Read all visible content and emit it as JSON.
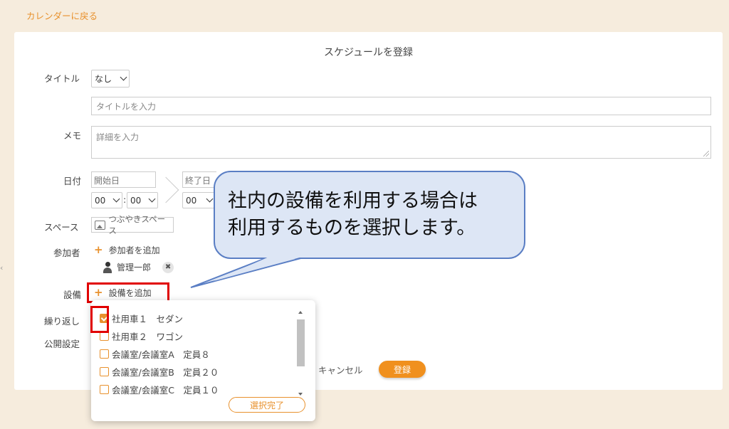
{
  "nav": {
    "back_label": "カレンダーに戻る",
    "left_arrow": "‹"
  },
  "form": {
    "title": "スケジュールを登録",
    "title_label": "タイトル",
    "title_select_value": "なし",
    "title_placeholder": "タイトルを入力",
    "memo_label": "メモ",
    "memo_placeholder": "詳細を入力",
    "date_label": "日付",
    "start_date_placeholder": "開始日",
    "end_date_placeholder": "終了日",
    "start_hour": "00",
    "time_colon": ":",
    "start_minute": "00",
    "end_hour": "00",
    "space_label": "スペース",
    "space_placeholder": "つぶやきスペース",
    "participants_label": "参加者",
    "add_participant_label": "参加者を追加",
    "participants": [
      {
        "name": "管理一郎"
      }
    ],
    "equipment_label": "設備",
    "add_equipment_label": "設備を追加",
    "repeat_label": "繰り返し",
    "visibility_label": "公開設定",
    "cancel_label": "キャンセル",
    "register_label": "登録"
  },
  "equipment_popup": {
    "items": [
      {
        "label": "社用車１　セダン",
        "checked": true
      },
      {
        "label": "社用車２　ワゴン",
        "checked": false
      },
      {
        "label": "会議室/会議室A　定員８",
        "checked": false
      },
      {
        "label": "会議室/会議室B　定員２０",
        "checked": false
      },
      {
        "label": "会議室/会議室C　定員１０",
        "checked": false
      }
    ],
    "done_label": "選択完了"
  },
  "callout": {
    "line1": "社内の設備を利用する場合は",
    "line2": "利用するものを選択します。"
  },
  "colors": {
    "accent": "#f0901e",
    "highlight": "#e10000",
    "callout_bg": "#dde6f5",
    "callout_border": "#5a7ec4"
  },
  "icons": [
    "plus-icon",
    "image-icon",
    "person-icon",
    "close-icon",
    "chevron-down-icon",
    "checkbox-icon"
  ]
}
